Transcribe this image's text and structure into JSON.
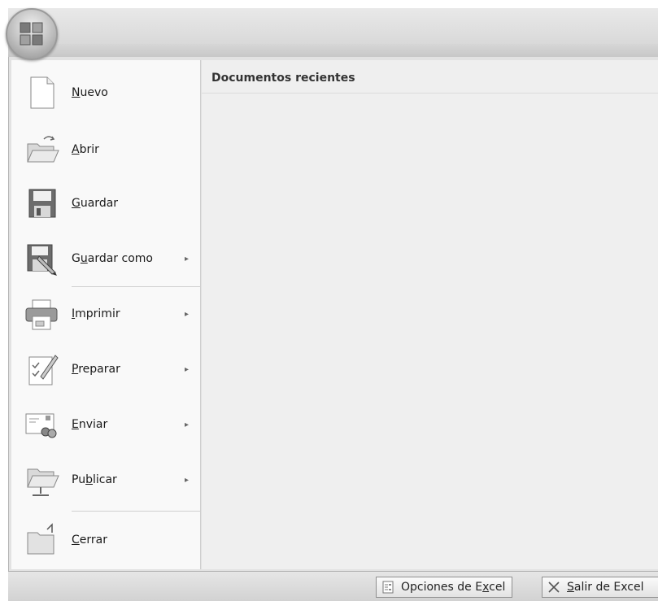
{
  "recent": {
    "header": "Documentos recientes"
  },
  "menu": {
    "items": [
      {
        "pre": "",
        "u": "N",
        "post": "uevo",
        "submenu": false
      },
      {
        "pre": "",
        "u": "A",
        "post": "brir",
        "submenu": false
      },
      {
        "pre": "",
        "u": "G",
        "post": "uardar",
        "submenu": false
      },
      {
        "pre": "G",
        "u": "u",
        "post": "ardar como",
        "submenu": true
      },
      {
        "pre": "",
        "u": "I",
        "post": "mprimir",
        "submenu": true
      },
      {
        "pre": "",
        "u": "P",
        "post": "reparar",
        "submenu": true
      },
      {
        "pre": "",
        "u": "E",
        "post": "nviar",
        "submenu": true
      },
      {
        "pre": "Pu",
        "u": "b",
        "post": "licar",
        "submenu": true
      },
      {
        "pre": "",
        "u": "C",
        "post": "errar",
        "submenu": false
      }
    ],
    "submenu_arrow": "▸"
  },
  "footer": {
    "options": {
      "pre": "Opciones de E",
      "u": "x",
      "post": "cel"
    },
    "exit": {
      "pre": "",
      "u": "S",
      "post": "alir de Excel"
    }
  }
}
